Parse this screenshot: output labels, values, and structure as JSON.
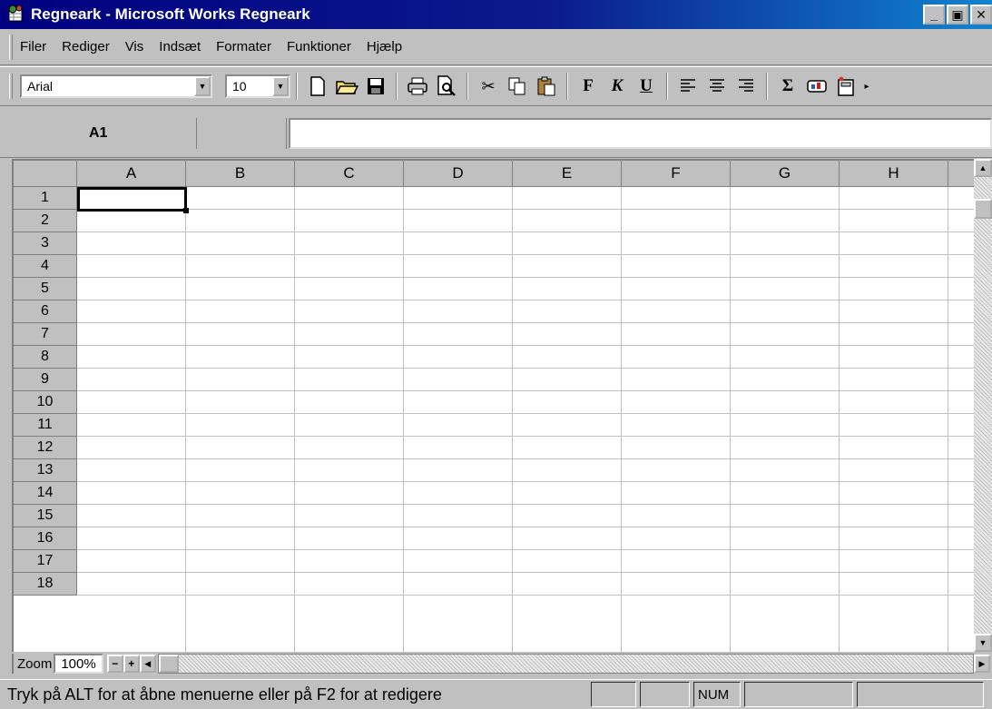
{
  "window": {
    "title": "Regneark - Microsoft Works Regneark",
    "icon": "works-spreadsheet-icon",
    "buttons": {
      "minimize": "_",
      "maximize": "▣",
      "close": "✕"
    }
  },
  "menubar": {
    "items": [
      {
        "label": "Filer"
      },
      {
        "label": "Rediger"
      },
      {
        "label": "Vis"
      },
      {
        "label": "Indsæt"
      },
      {
        "label": "Formater"
      },
      {
        "label": "Funktioner"
      },
      {
        "label": "Hjælp"
      }
    ]
  },
  "toolbar": {
    "font_name": "Arial",
    "font_size": "10",
    "bold_label": "F",
    "italic_label": "K",
    "underline_label": "U",
    "sum_label": "Σ"
  },
  "formula_bar": {
    "cell_reference": "A1",
    "formula_value": ""
  },
  "grid": {
    "columns": [
      "A",
      "B",
      "C",
      "D",
      "E",
      "F",
      "G",
      "H"
    ],
    "rows": [
      "1",
      "2",
      "3",
      "4",
      "5",
      "6",
      "7",
      "8",
      "9",
      "10",
      "11",
      "12",
      "13",
      "14",
      "15",
      "16",
      "17",
      "18"
    ],
    "active_cell": "A1"
  },
  "bottom_bar": {
    "zoom_label": "Zoom",
    "zoom_value": "100%",
    "zoom_minus": "−",
    "zoom_plus": "+"
  },
  "statusbar": {
    "message": "Tryk på ALT for at åbne menuerne eller på F2 for at redigere",
    "indicator_num": "NUM"
  },
  "colors": {
    "title_gradient_start": "#000080",
    "title_gradient_end": "#1084d0",
    "chrome": "#c0c0c0",
    "gridline": "#c0c0c0"
  }
}
